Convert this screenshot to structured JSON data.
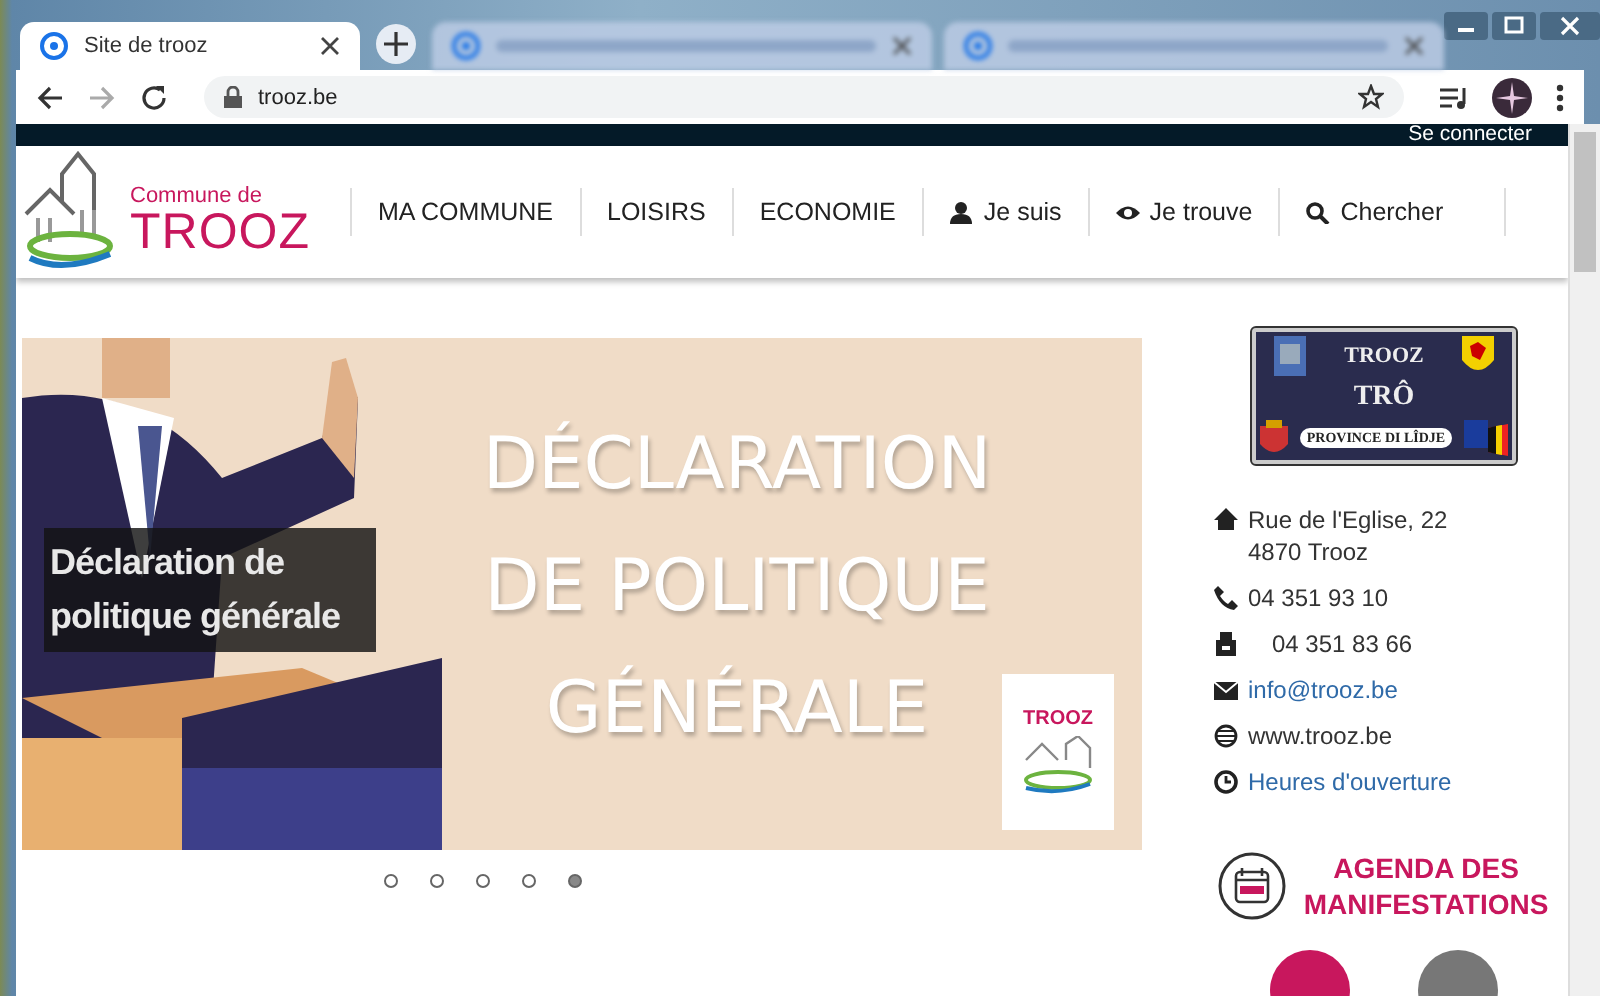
{
  "browser": {
    "tabs": [
      {
        "title": "Site de trooz",
        "selected": true
      },
      {
        "selected": false
      },
      {
        "selected": false
      }
    ],
    "address": "trooz.be"
  },
  "top_bar": {
    "login": "Se connecter"
  },
  "logo": {
    "line1": "Commune de",
    "line2": "TROOZ"
  },
  "nav": [
    {
      "label": "MA COMMUNE",
      "kind": "plain"
    },
    {
      "label": "LOISIRS",
      "kind": "plain"
    },
    {
      "label": "ECONOMIE",
      "kind": "plain"
    },
    {
      "label": "Je suis",
      "kind": "user"
    },
    {
      "label": "Je trouve",
      "kind": "eye"
    },
    {
      "label": "Chercher",
      "kind": "search"
    }
  ],
  "slider": {
    "caption": "Déclaration de politique générale",
    "banner_title": "DÉCLARATION DE POLITIQUE GÉNÉRALE",
    "banner_logo": "TROOZ",
    "dots": [
      {
        "selected": false
      },
      {
        "selected": false
      },
      {
        "selected": false
      },
      {
        "selected": false
      },
      {
        "selected": true
      }
    ]
  },
  "sidebar": {
    "sign": {
      "top": "TROOZ",
      "main": "TRÔ",
      "plate": "PROVINCE DI LÎDJE"
    },
    "contacts": [
      {
        "kind": "home",
        "lines": [
          "Rue de l'Eglise, 22",
          "4870 Trooz"
        ],
        "link": false
      },
      {
        "kind": "phone",
        "lines": [
          "04 351 93 10"
        ],
        "link": false
      },
      {
        "kind": "fax",
        "lines": [
          "04 351 83 66"
        ],
        "link": false
      },
      {
        "kind": "mail",
        "lines": [
          "info@trooz.be"
        ],
        "link": true
      },
      {
        "kind": "globe",
        "lines": [
          "www.trooz.be"
        ],
        "link": false
      },
      {
        "kind": "clock",
        "lines": [
          "Heures d'ouverture"
        ],
        "link": true
      }
    ],
    "agenda": {
      "label": "AGENDA DES MANIFESTATIONS"
    }
  }
}
